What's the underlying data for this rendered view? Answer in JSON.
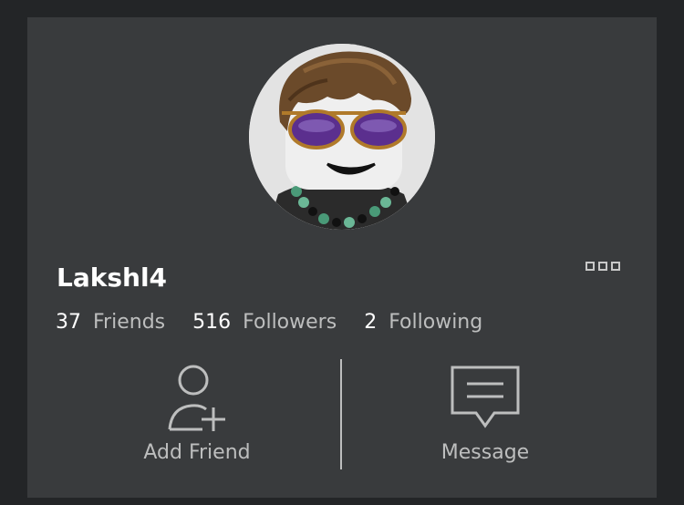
{
  "profile": {
    "username": "Lakshl4",
    "avatar_icon": "avatar-headshot",
    "more_icon": "more-options-icon"
  },
  "stats": [
    {
      "count": "37",
      "label": "Friends"
    },
    {
      "count": "516",
      "label": "Followers"
    },
    {
      "count": "2",
      "label": "Following"
    }
  ],
  "actions": {
    "add_friend": {
      "label": "Add Friend",
      "icon": "add-friend-icon"
    },
    "message": {
      "label": "Message",
      "icon": "message-icon"
    }
  },
  "colors": {
    "background": "#232527",
    "card": "#393b3d",
    "text_primary": "#ffffff",
    "text_secondary": "#bdbebe"
  }
}
